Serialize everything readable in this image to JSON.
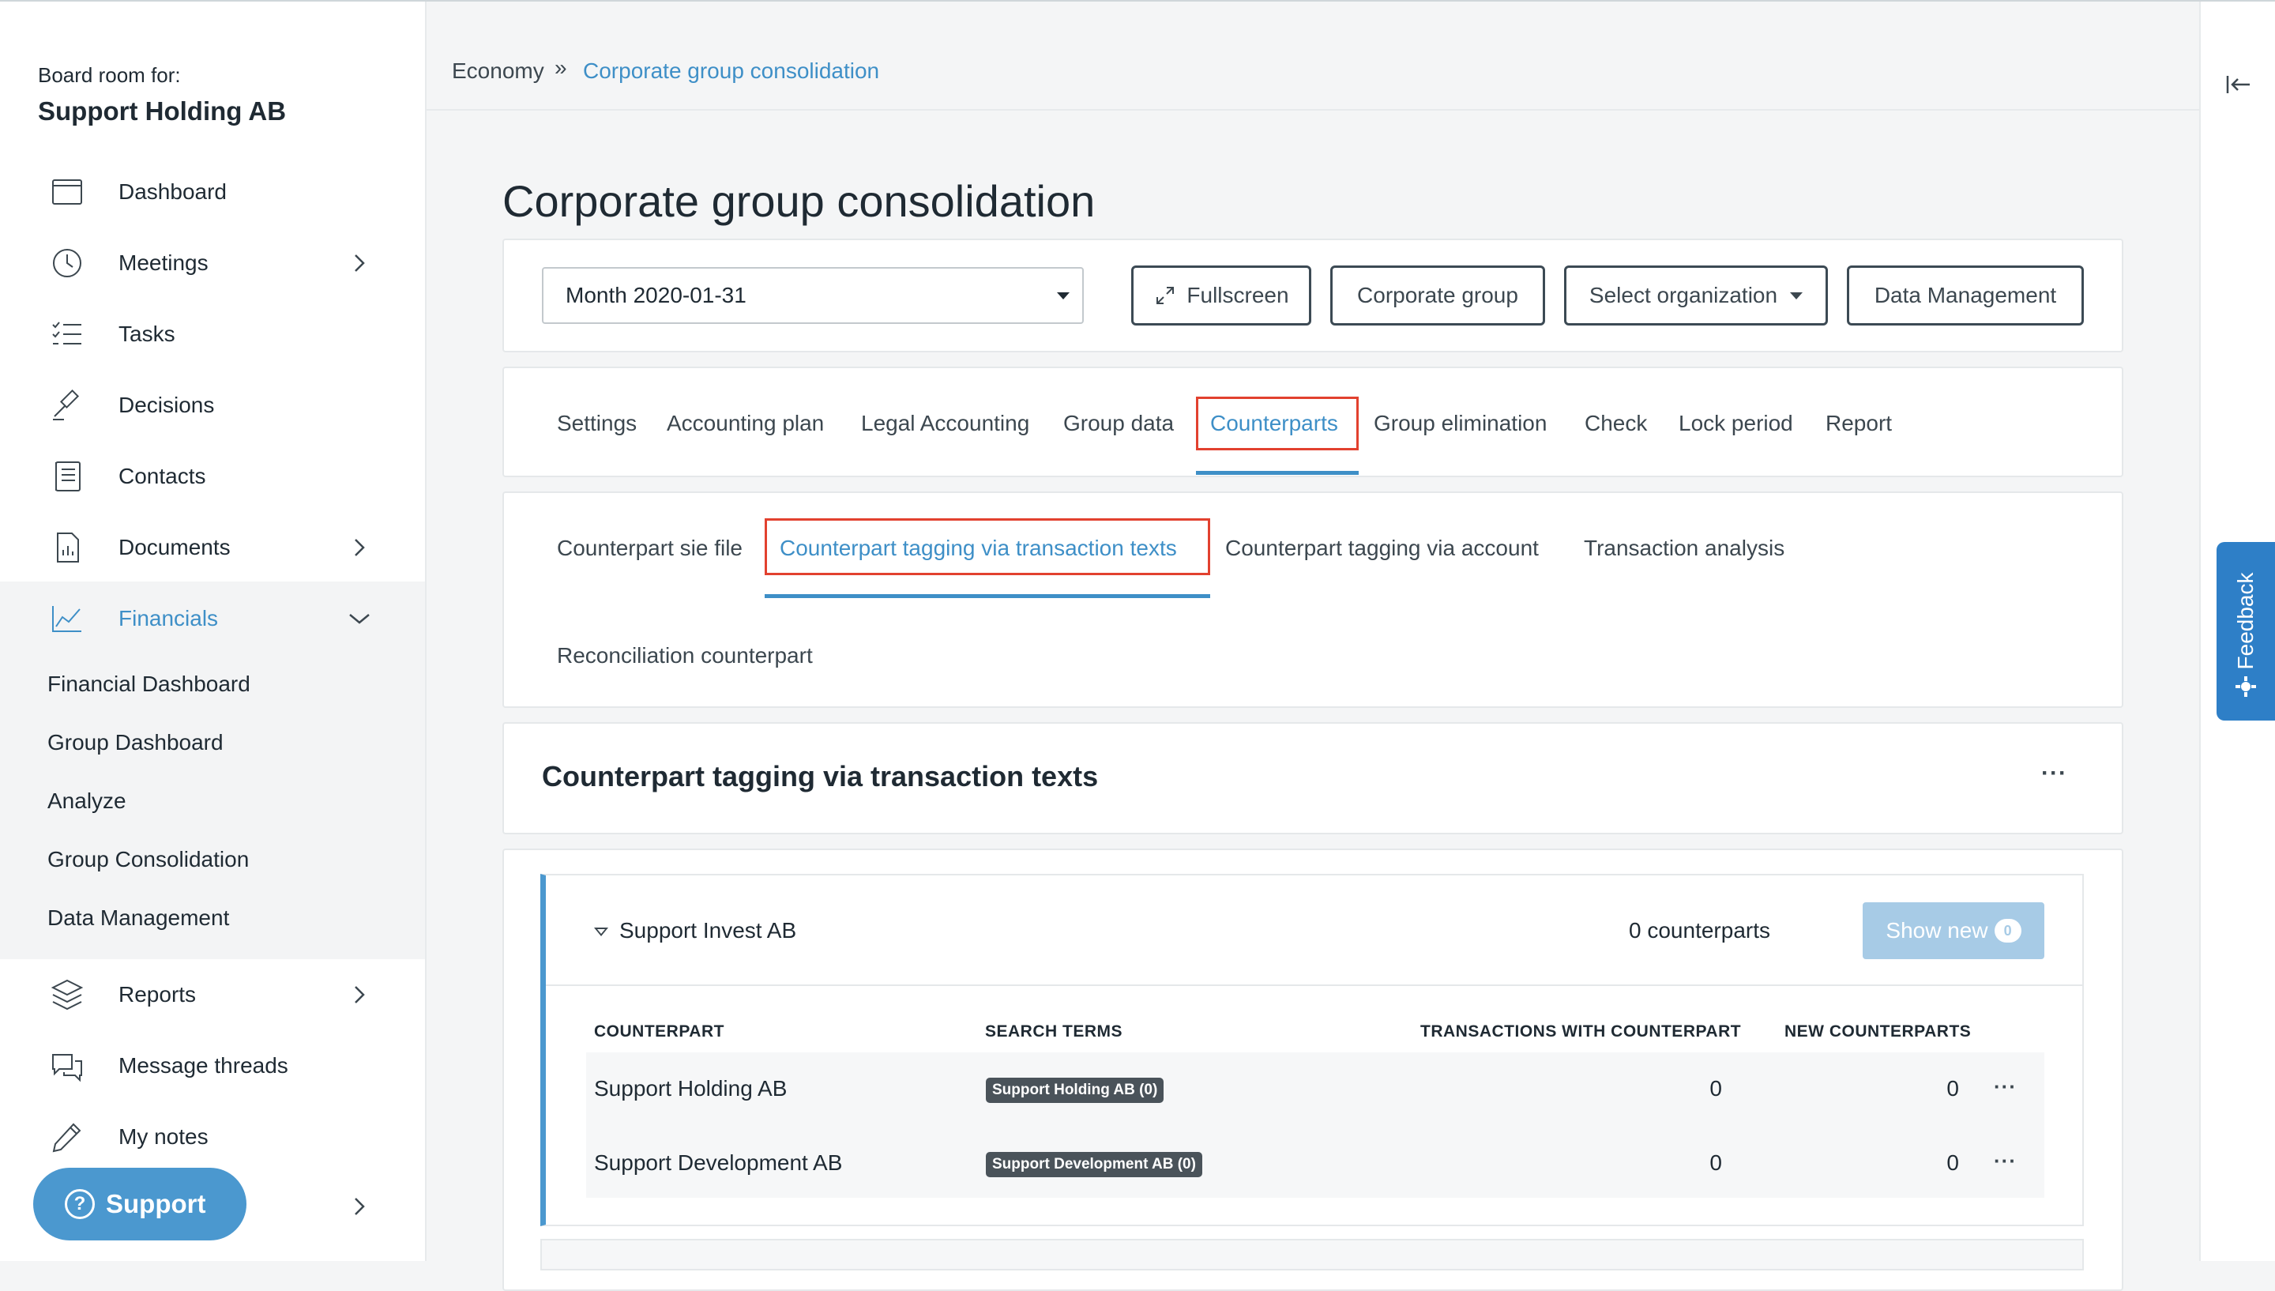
{
  "sidebar": {
    "board_label": "Board room for:",
    "org_name": "Support Holding AB",
    "items": [
      {
        "label": "Dashboard",
        "icon": "calendar-icon"
      },
      {
        "label": "Meetings",
        "icon": "clock-icon"
      },
      {
        "label": "Tasks",
        "icon": "checklist-icon"
      },
      {
        "label": "Decisions",
        "icon": "gavel-icon"
      },
      {
        "label": "Contacts",
        "icon": "address-book-icon"
      },
      {
        "label": "Documents",
        "icon": "document-icon"
      },
      {
        "label": "Financials",
        "icon": "line-chart-icon"
      },
      {
        "label": "Reports",
        "icon": "layers-icon"
      },
      {
        "label": "Message threads",
        "icon": "chat-bubbles-icon"
      },
      {
        "label": "My notes",
        "icon": "pencil-icon"
      }
    ],
    "financials_sub": [
      "Financial Dashboard",
      "Group Dashboard",
      "Analyze",
      "Group Consolidation",
      "Data Management"
    ],
    "support_label": "Support"
  },
  "breadcrumb": {
    "home": "Economy",
    "separator": "»",
    "current": "Corporate group consolidation"
  },
  "page": {
    "title": "Corporate group consolidation"
  },
  "toolbar": {
    "period_select": "Month 2020-01-31",
    "fullscreen": "Fullscreen",
    "corporate_group": "Corporate group",
    "select_org": "Select organization",
    "data_management": "Data Management"
  },
  "tabs": [
    "Settings",
    "Accounting plan",
    "Legal Accounting",
    "Group data",
    "Counterparts",
    "Group elimination",
    "Check",
    "Lock period",
    "Report"
  ],
  "active_tab": "Counterparts",
  "subtabs": [
    "Counterpart sie file",
    "Counterpart tagging via transaction texts",
    "Counterpart tagging via account",
    "Transaction analysis",
    "Reconciliation counterpart"
  ],
  "active_subtab": "Counterpart tagging via transaction texts",
  "section": {
    "title": "Counterpart tagging via transaction texts",
    "menu": "···"
  },
  "group": {
    "name": "Support Invest AB",
    "count_label": "0 counterparts",
    "show_new_label": "Show new",
    "show_new_count": "0"
  },
  "table": {
    "headers": [
      "COUNTERPART",
      "SEARCH TERMS",
      "TRANSACTIONS WITH COUNTERPART",
      "NEW COUNTERPARTS"
    ],
    "rows": [
      {
        "counterpart": "Support Holding AB",
        "tag": "Support Holding AB (0)",
        "transactions": "0",
        "new": "0"
      },
      {
        "counterpart": "Support Development AB",
        "tag": "Support Development AB (0)",
        "transactions": "0",
        "new": "0"
      }
    ]
  },
  "feedback": {
    "label": "Feedback"
  },
  "colors": {
    "accent": "#3e8fc7",
    "highlight": "#e2412f",
    "feedback": "#2e7fc7",
    "support": "#4b98cf"
  }
}
